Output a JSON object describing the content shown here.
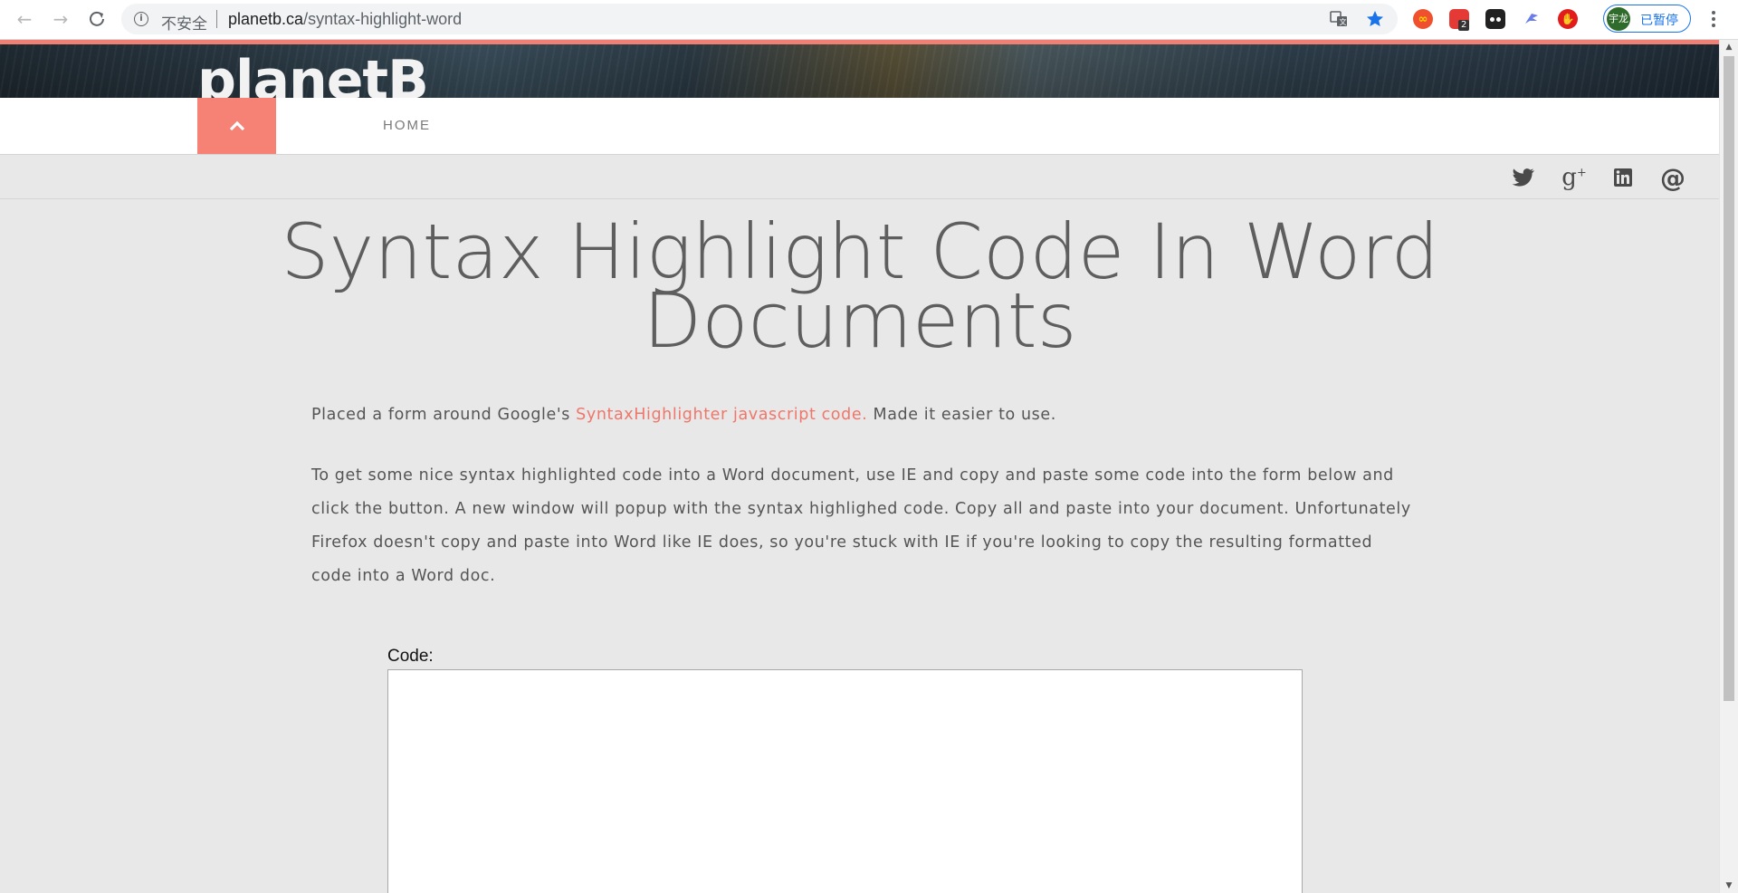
{
  "browser": {
    "security_label": "不安全",
    "url_host": "planetb.ca",
    "url_path": "/syntax-highlight-word",
    "profile_initials": "宇龙",
    "profile_status": "已暂停",
    "extension_badge": "2",
    "star_color": "#1a73e8"
  },
  "site": {
    "logo": "planetB",
    "nav_toggle_icon": "chevron-up-icon",
    "nav_items": [
      {
        "label": "HOME"
      }
    ],
    "accent_color": "#f58275",
    "social_icons": [
      "twitter-icon",
      "google-plus-icon",
      "linkedin-icon",
      "email-at-icon"
    ]
  },
  "article": {
    "title": "Syntax Highlight Code In Word Documents",
    "intro_prefix": "Placed a form around Google's ",
    "intro_link": "SyntaxHighlighter javascript code.",
    "intro_suffix": " Made it easier to use.",
    "paragraph": "To get some nice syntax highlighted code into a Word document, use IE and copy and paste some code into the form below and click the button. A new window will popup with the syntax highlighed code. Copy all and paste into your document. Unfortunately Firefox doesn't copy and paste into Word like IE does, so you're stuck with IE if you're looking to copy the resulting formatted code into a Word doc."
  },
  "form": {
    "code_label": "Code:",
    "code_value": ""
  }
}
